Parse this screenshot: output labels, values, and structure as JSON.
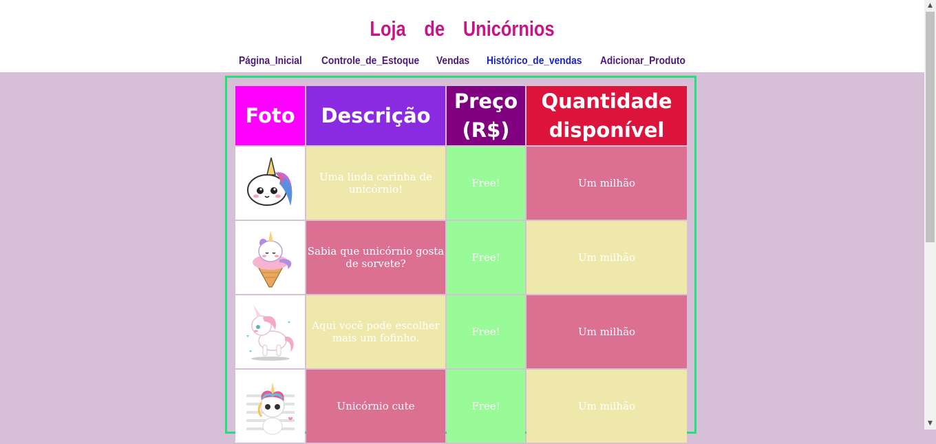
{
  "header": {
    "title": "Loja de Unicórnios",
    "nav": [
      {
        "label": "Página_Inicial"
      },
      {
        "label": "Controle_de_Estoque"
      },
      {
        "label": "Vendas"
      },
      {
        "label": "Histórico_de_vendas"
      },
      {
        "label": "Adicionar_Produto"
      }
    ]
  },
  "table": {
    "columns": [
      {
        "label": "Foto",
        "color": "#ff00ff"
      },
      {
        "label": "Descrição",
        "color": "#8a2be2"
      },
      {
        "label": "Preço (R$)",
        "color": "#800080"
      },
      {
        "label": "Quantidade disponível",
        "color": "#dc143c"
      }
    ],
    "rows": [
      {
        "image": "unicorn-face-image",
        "description": "Uma linda carinha de unicórnio!",
        "price": "Free!",
        "quantity": "Um milhão"
      },
      {
        "image": "unicorn-ice-cream-image",
        "description": "Sabia que unicórnio gosta de sorvete?",
        "price": "Free!",
        "quantity": "Um milhão"
      },
      {
        "image": "unicorn-pony-image",
        "description": "Aqui você pode escolher mais um fofinho.",
        "price": "Free!",
        "quantity": "Um milhão"
      },
      {
        "image": "unicorn-cute-image",
        "description": "Unicórnio cute",
        "price": "Free!",
        "quantity": "Um milhão"
      }
    ]
  },
  "colors": {
    "background": "#d8bfd8",
    "title": "#c71585",
    "frame_border": "#22e07a",
    "pink_cell": "#db7093",
    "khaki_cell": "#eee8aa",
    "price_cell": "#98fb98"
  }
}
